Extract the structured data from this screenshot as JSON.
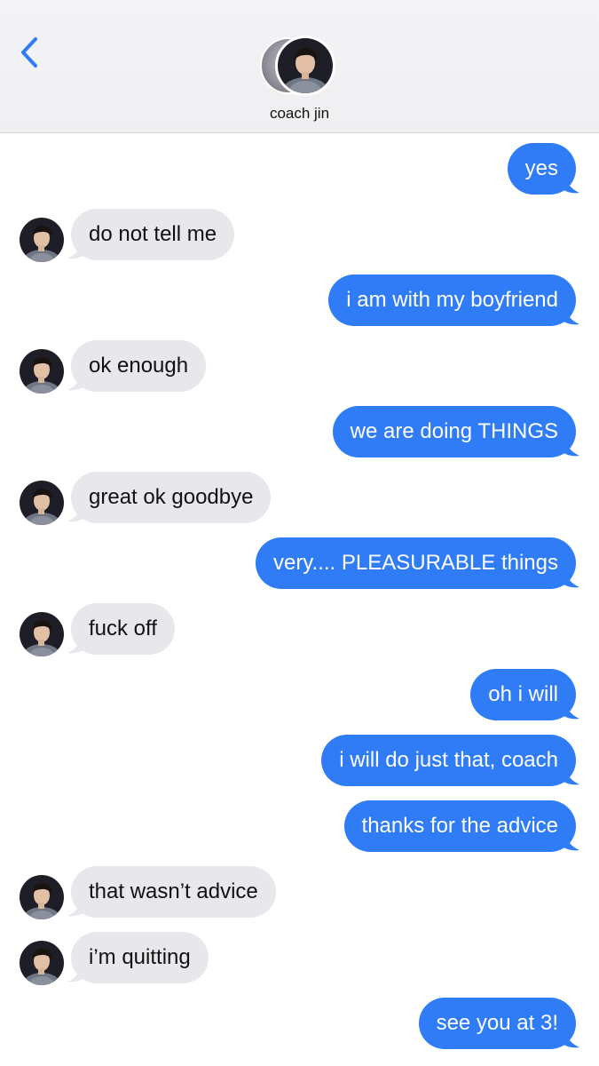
{
  "header": {
    "contact_name": "coach jin",
    "back_icon": "chevron-left-icon"
  },
  "colors": {
    "sent_bubble": "#2f7cf6",
    "received_bubble": "#e8e8ec",
    "accent": "#2f7cf6"
  },
  "messages": [
    {
      "from": "me",
      "text": "yes"
    },
    {
      "from": "contact",
      "text": "do not tell me"
    },
    {
      "from": "me",
      "text": "i am with my boyfriend"
    },
    {
      "from": "contact",
      "text": "ok enough"
    },
    {
      "from": "me",
      "text": "we are doing THINGS"
    },
    {
      "from": "contact",
      "text": "great ok goodbye"
    },
    {
      "from": "me",
      "text": "very.... PLEASURABLE things"
    },
    {
      "from": "contact",
      "text": "fuck off"
    },
    {
      "from": "me",
      "text": "oh i will"
    },
    {
      "from": "me",
      "text": "i will do just that, coach"
    },
    {
      "from": "me",
      "text": "thanks for the advice"
    },
    {
      "from": "contact",
      "text": "that wasn’t advice"
    },
    {
      "from": "contact",
      "text": "i’m quitting"
    },
    {
      "from": "me",
      "text": "see you at 3!"
    }
  ]
}
